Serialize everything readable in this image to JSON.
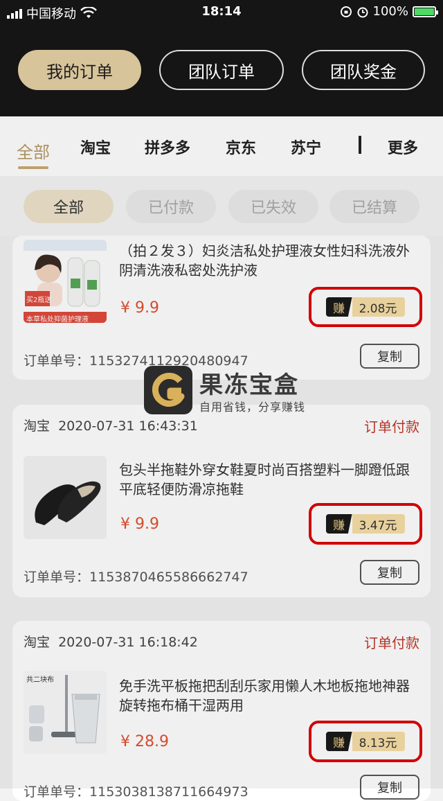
{
  "status_bar": {
    "carrier": "中国移动",
    "time": "18:14",
    "battery": "100%"
  },
  "segments": [
    {
      "label": "我的订单"
    },
    {
      "label": "团队订单"
    },
    {
      "label": "团队奖金"
    }
  ],
  "platform_tabs": [
    "全部",
    "淘宝",
    "拼多多",
    "京东",
    "苏宁",
    "更多"
  ],
  "filters": [
    "全部",
    "已付款",
    "已失效",
    "已结算"
  ],
  "watermark": {
    "title": "果冻宝盒",
    "subtitle": "自用省钱，分享赚钱"
  },
  "orders": [
    {
      "source": "",
      "datetime": "",
      "status": "",
      "title": "（拍２发３）妇炎洁私处护理液女性妇科洗液外阴清洗液私密处洗护液",
      "price": "¥ 9.9",
      "earn_label": "赚",
      "earn_amount": "2.08元",
      "order_no_label": "订单单号：",
      "order_no": "1153274112920480947",
      "copy": "复制",
      "thumb_text_1": "买2瓶送",
      "thumb_text_2": "本草私处抑菌护理液"
    },
    {
      "source": "淘宝",
      "datetime": "2020-07-31 16:43:31",
      "status": "订单付款",
      "title": "包头半拖鞋外穿女鞋夏时尚百搭塑料一脚蹬低跟平底轻便防滑凉拖鞋",
      "price": "¥ 9.9",
      "earn_label": "赚",
      "earn_amount": "3.47元",
      "order_no_label": "订单单号：",
      "order_no": "1153870465586662747",
      "copy": "复制"
    },
    {
      "source": "淘宝",
      "datetime": "2020-07-31 16:18:42",
      "status": "订单付款",
      "title": "免手洗平板拖把刮刮乐家用懒人木地板拖地神器旋转拖布桶干湿两用",
      "price": "¥ 28.9",
      "earn_label": "赚",
      "earn_amount": "8.13元",
      "order_no_label": "订单单号：",
      "order_no": "1153038138711664973",
      "copy": "复制",
      "thumb_text_1": "共二块布"
    }
  ]
}
